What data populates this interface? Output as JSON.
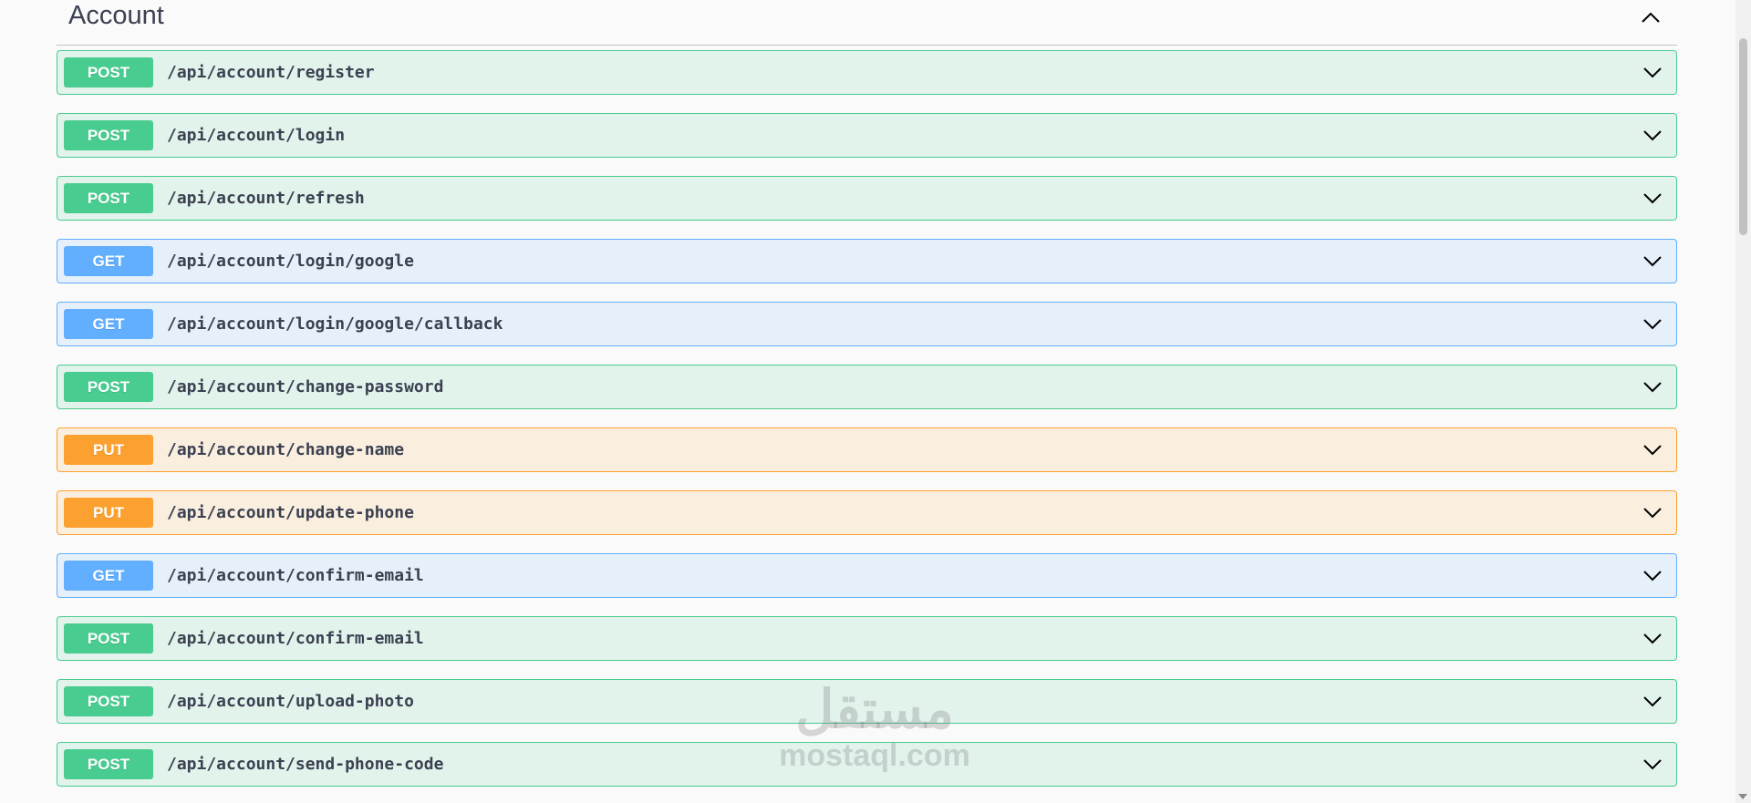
{
  "section": {
    "title": "Account",
    "toggle_icon": "chevron-up-icon"
  },
  "operations": [
    {
      "method": "POST",
      "path": "/api/account/register"
    },
    {
      "method": "POST",
      "path": "/api/account/login"
    },
    {
      "method": "POST",
      "path": "/api/account/refresh"
    },
    {
      "method": "GET",
      "path": "/api/account/login/google"
    },
    {
      "method": "GET",
      "path": "/api/account/login/google/callback"
    },
    {
      "method": "POST",
      "path": "/api/account/change-password"
    },
    {
      "method": "PUT",
      "path": "/api/account/change-name"
    },
    {
      "method": "PUT",
      "path": "/api/account/update-phone"
    },
    {
      "method": "GET",
      "path": "/api/account/confirm-email"
    },
    {
      "method": "POST",
      "path": "/api/account/confirm-email"
    },
    {
      "method": "POST",
      "path": "/api/account/upload-photo"
    },
    {
      "method": "POST",
      "path": "/api/account/send-phone-code"
    }
  ],
  "colors": {
    "post": "#49cc90",
    "get": "#61affe",
    "put": "#fca130",
    "text": "#3b4151"
  },
  "watermark": {
    "arabic": "مستقل",
    "latin": "mostaql.com"
  }
}
